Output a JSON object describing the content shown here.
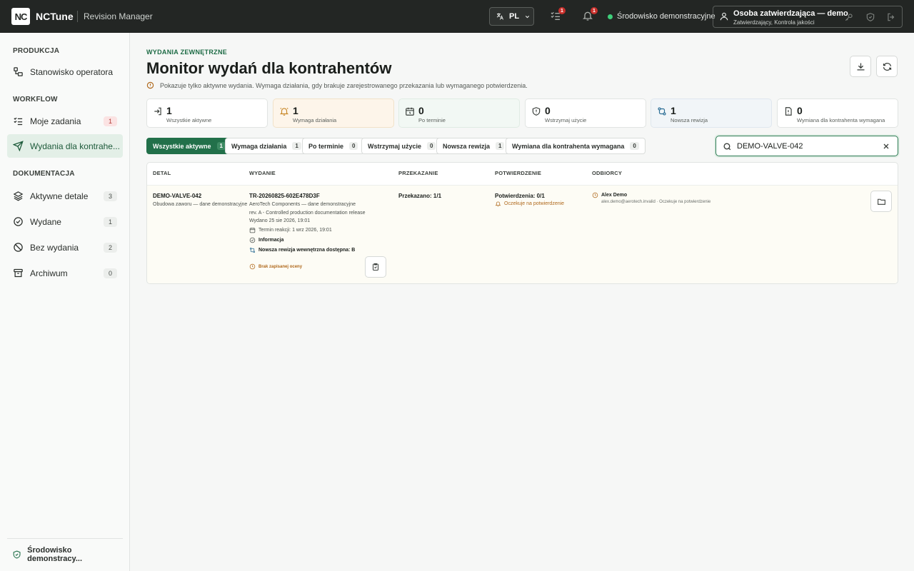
{
  "topbar": {
    "logo_text": "NC",
    "brand": "NCTune",
    "subtitle": "Revision Manager",
    "language": "PL",
    "tasks_badge": "1",
    "notifications_badge": "1",
    "environment": "Środowisko demonstracyjne",
    "user_name": "Osoba zatwierdzająca — demo",
    "user_roles": "Zatwierdzający, Kontrola jakości"
  },
  "sidebar": {
    "sections": [
      {
        "heading": "PRODUKCJA"
      },
      {
        "heading": "WORKFLOW"
      },
      {
        "heading": "DOKUMENTACJA"
      }
    ],
    "items": [
      {
        "label": "Stanowisko operatora",
        "icon": "workflow-icon"
      },
      {
        "label": "Moje zadania",
        "count": "1",
        "icon": "tasks-icon"
      },
      {
        "label": "Wydania dla kontrahe...",
        "icon": "send-icon"
      },
      {
        "label": "Aktywne detale",
        "count": "3",
        "icon": "layers-icon"
      },
      {
        "label": "Wydane",
        "count": "1",
        "icon": "check-circle-icon"
      },
      {
        "label": "Bez wydania",
        "count": "2",
        "icon": "no-release-icon"
      },
      {
        "label": "Archiwum",
        "count": "0",
        "icon": "archive-icon"
      }
    ],
    "footer": "Środowisko demonstracy..."
  },
  "header": {
    "kicker": "WYDANIA ZEWNĘTRZNE",
    "title": "Monitor wydań dla kontrahentów",
    "note": "Pokazuje tylko aktywne wydania. Wymaga działania, gdy brakuje zarejestrowanego przekazania lub wymaganego potwierdzenia."
  },
  "stats": [
    {
      "value": "1",
      "label": "Wszystkie aktywne"
    },
    {
      "value": "1",
      "label": "Wymaga działania"
    },
    {
      "value": "0",
      "label": "Po terminie"
    },
    {
      "value": "0",
      "label": "Wstrzymaj użycie"
    },
    {
      "value": "1",
      "label": "Nowsza rewizja"
    },
    {
      "value": "0",
      "label": "Wymiana dla kontrahenta wymagana"
    }
  ],
  "filters": [
    {
      "label": "Wszystkie aktywne",
      "count": "1"
    },
    {
      "label": "Wymaga działania",
      "count": "1"
    },
    {
      "label": "Po terminie",
      "count": "0"
    },
    {
      "label": "Wstrzymaj użycie",
      "count": "0"
    },
    {
      "label": "Nowsza rewizja",
      "count": "1"
    },
    {
      "label": "Wymiana dla kontrahenta wymagana",
      "count": "0"
    }
  ],
  "search": {
    "value": "DEMO-VALVE-042"
  },
  "table": {
    "headers": [
      "DETAL",
      "WYDANIE",
      "PRZEKAZANIE",
      "POTWIERDZENIE",
      "ODBIORCY"
    ],
    "row": {
      "part": "DEMO-VALVE-042",
      "part_desc": "Obudowa zaworu — dane demonstracyjne",
      "release_id": "TR-20260825-602E478D3F",
      "company": "AeroTech Components — dane demonstracyjne",
      "revision": "rev. A - Controlled production documentation release",
      "issued": "Wydano 25 sie 2026, 19:01",
      "deadline": "Termin reakcji: 1 wrz 2026, 19:01",
      "info": "Informacja",
      "newer_revision": "Nowsza rewizja wewnętrzna dostępna: B",
      "no_rating": "Brak zapisanej oceny",
      "handover": "Przekazano: 1/1",
      "confirmations": "Potwierdzenia: 0/1",
      "awaiting": "Oczekuje na potwierdzenie",
      "recipient_name": "Alex Demo",
      "recipient_email": "alex.demo@aerotech.invalid",
      "recipient_status": "Oczekuje na potwierdzenie"
    }
  },
  "colors": {
    "accent": "#22704a",
    "topbar": "#232624",
    "warning": "#b0691c",
    "badge": "#c9302c"
  }
}
